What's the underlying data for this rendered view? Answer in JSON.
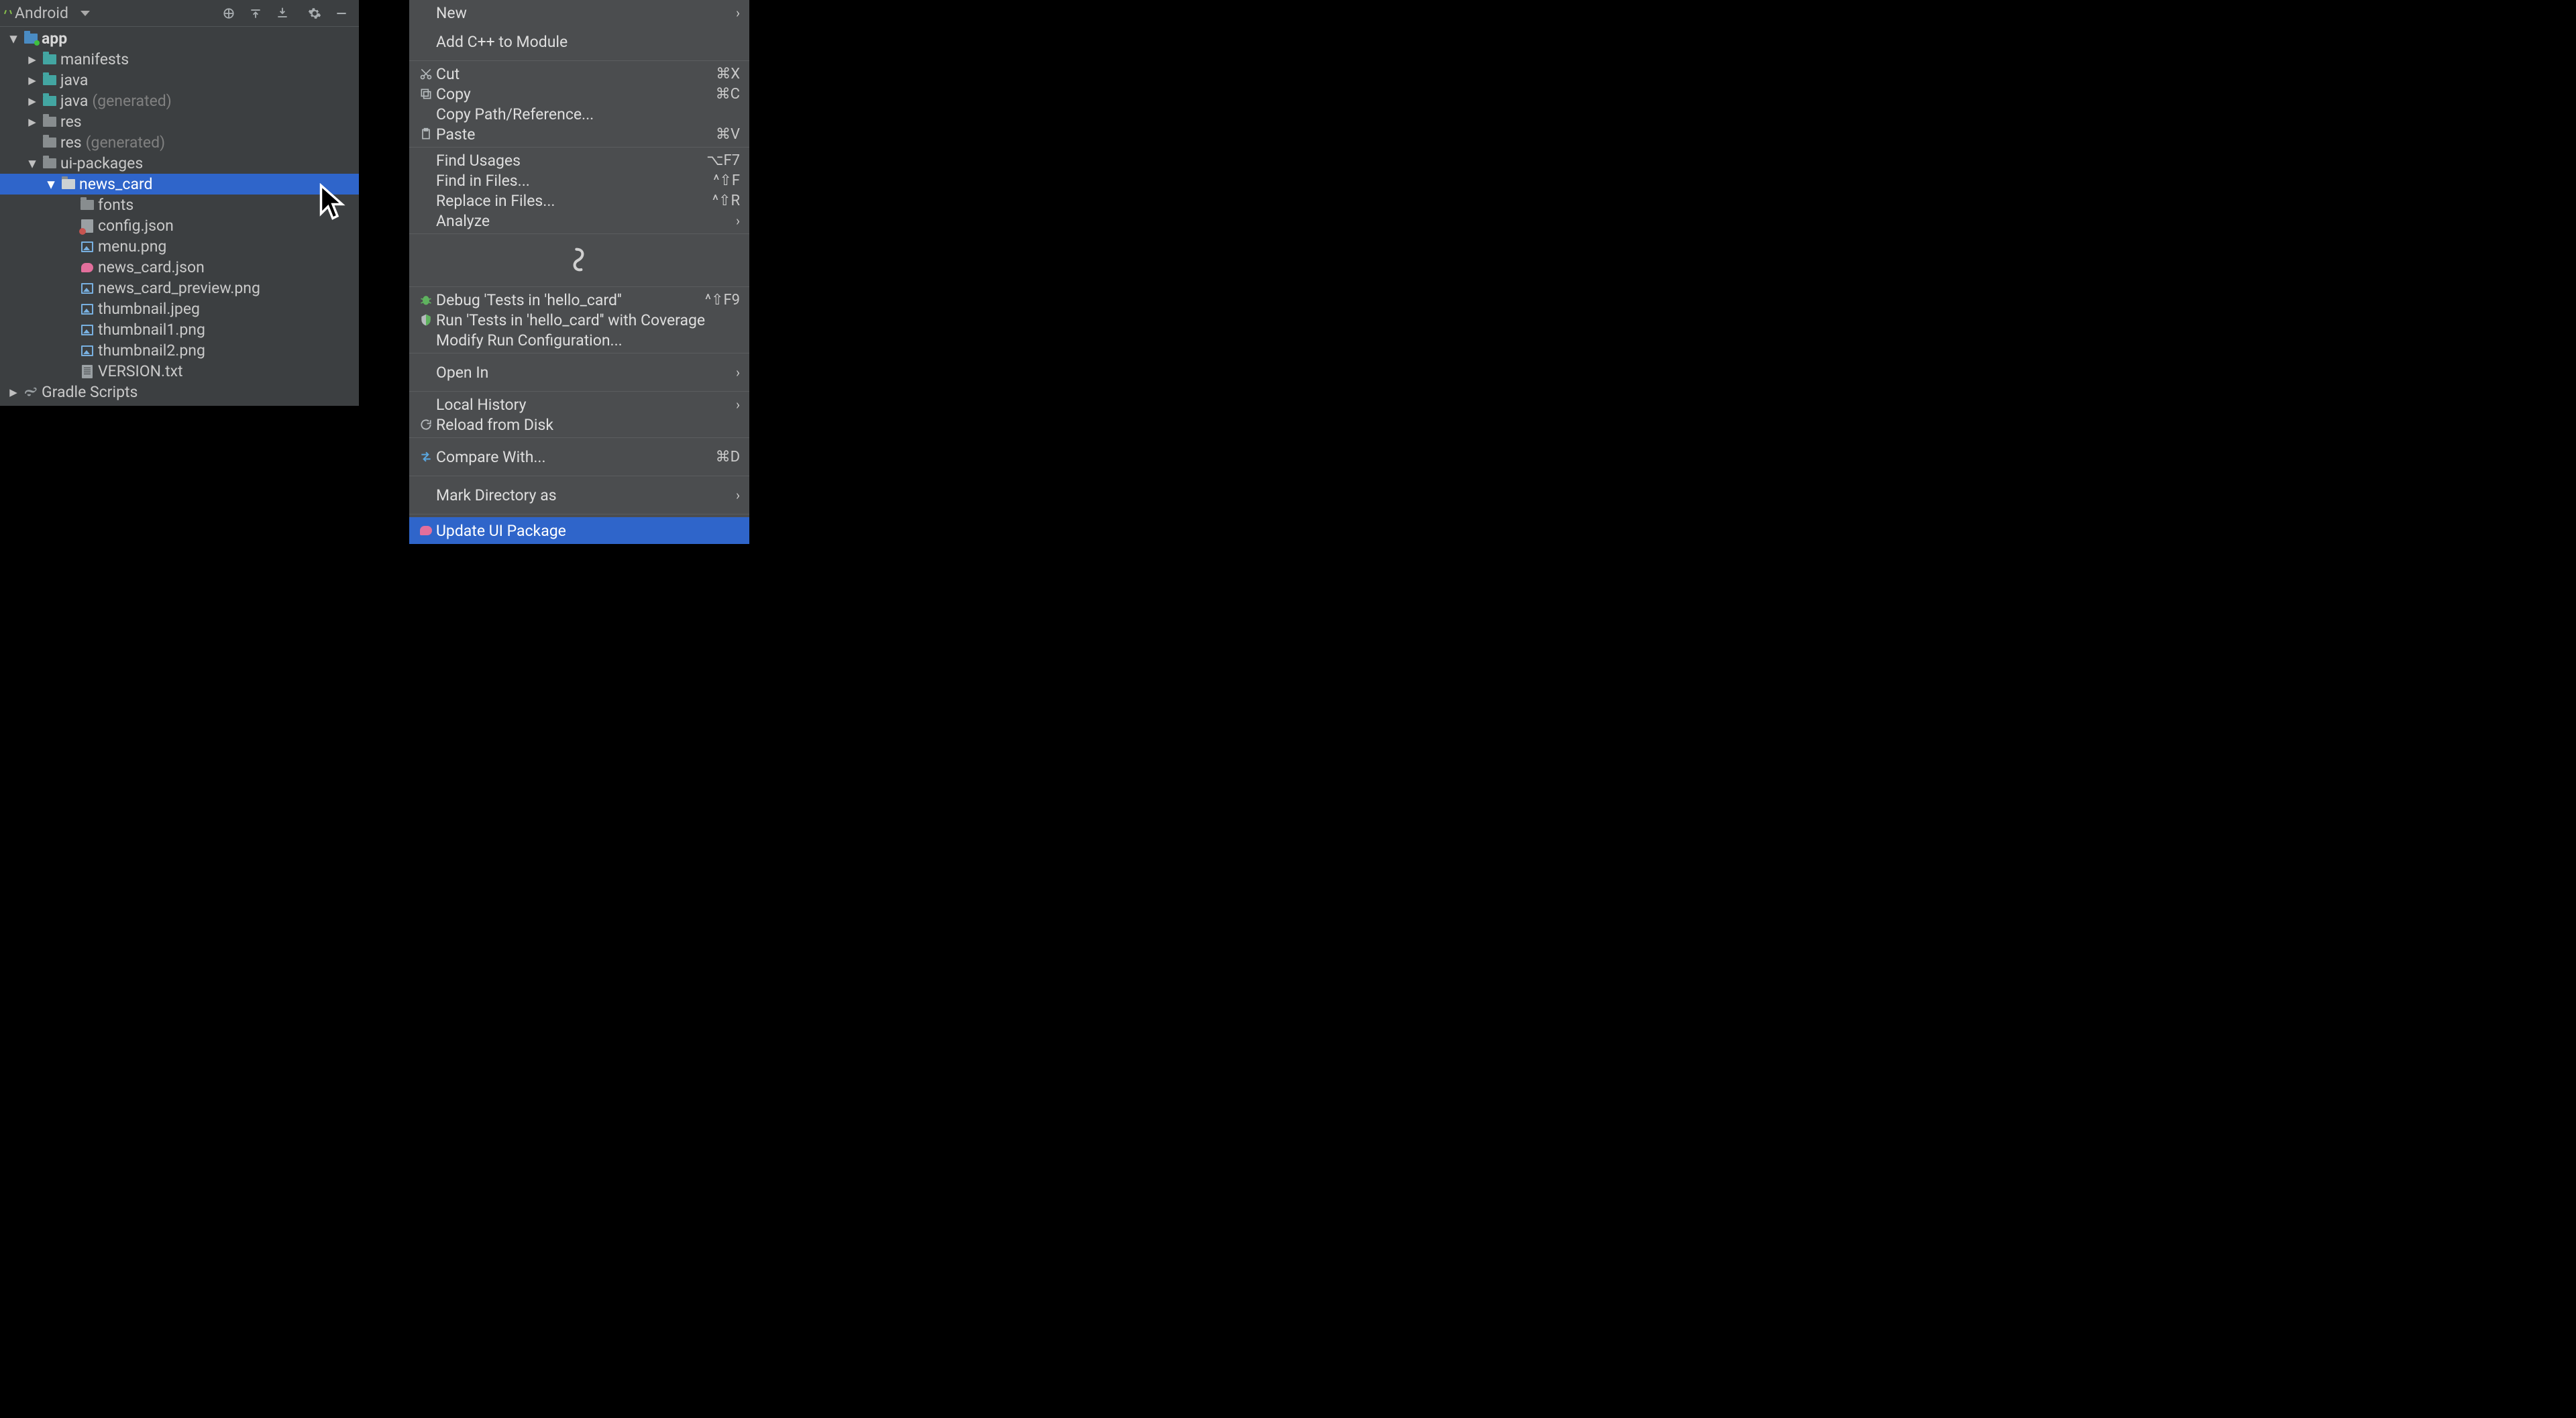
{
  "panel": {
    "title": "Android"
  },
  "tree": {
    "app": {
      "label": "app"
    },
    "manifests": {
      "label": "manifests"
    },
    "java": {
      "label": "java"
    },
    "java_gen": {
      "label": "java",
      "suffix": "(generated)"
    },
    "res": {
      "label": "res"
    },
    "res_gen": {
      "label": "res",
      "suffix": "(generated)"
    },
    "ui_packages": {
      "label": "ui-packages"
    },
    "news_card": {
      "label": "news_card"
    },
    "fonts": {
      "label": "fonts"
    },
    "config_json": {
      "label": "config.json"
    },
    "menu_png": {
      "label": "menu.png"
    },
    "news_card_json": {
      "label": "news_card.json"
    },
    "news_card_preview": {
      "label": "news_card_preview.png"
    },
    "thumbnail_jpeg": {
      "label": "thumbnail.jpeg"
    },
    "thumbnail1": {
      "label": "thumbnail1.png"
    },
    "thumbnail2": {
      "label": "thumbnail2.png"
    },
    "version": {
      "label": "VERSION.txt"
    },
    "gradle": {
      "label": "Gradle Scripts"
    }
  },
  "menu": {
    "new": {
      "label": "New"
    },
    "add_cpp": {
      "label": "Add C++ to Module"
    },
    "cut": {
      "label": "Cut",
      "shortcut": "⌘X"
    },
    "copy": {
      "label": "Copy",
      "shortcut": "⌘C"
    },
    "copy_path": {
      "label": "Copy Path/Reference..."
    },
    "paste": {
      "label": "Paste",
      "shortcut": "⌘V"
    },
    "find_usages": {
      "label": "Find Usages",
      "shortcut": "⌥F7"
    },
    "find_in_files": {
      "label": "Find in Files...",
      "shortcut": "^⇧F"
    },
    "replace_in_files": {
      "label": "Replace in Files...",
      "shortcut": "^⇧R"
    },
    "analyze": {
      "label": "Analyze"
    },
    "debug_tests": {
      "label": "Debug 'Tests in 'hello_card''",
      "shortcut": "^⇧F9"
    },
    "run_coverage": {
      "label": "Run 'Tests in 'hello_card'' with Coverage"
    },
    "modify_run": {
      "label": "Modify Run Configuration..."
    },
    "open_in": {
      "label": "Open In"
    },
    "local_history": {
      "label": "Local History"
    },
    "reload": {
      "label": "Reload from Disk"
    },
    "compare": {
      "label": "Compare With...",
      "shortcut": "⌘D"
    },
    "mark_dir": {
      "label": "Mark Directory as"
    },
    "update_ui": {
      "label": "Update UI Package"
    }
  }
}
